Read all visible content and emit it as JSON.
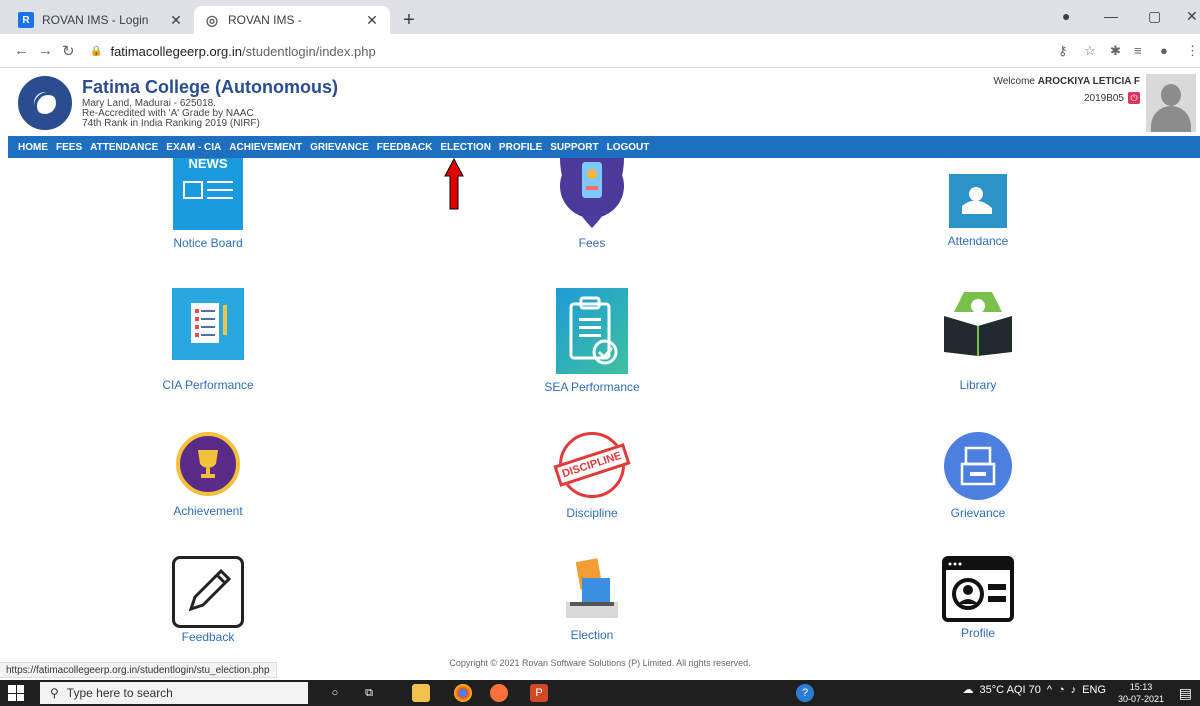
{
  "browser": {
    "tabs": [
      {
        "title": "ROVAN IMS - Login",
        "favicon": "R"
      },
      {
        "title": "ROVAN IMS -",
        "favicon": "globe"
      }
    ],
    "url_host": "fatimacollegeerp.org.in",
    "url_path": "/studentlogin/index.php",
    "status_url": "https://fatimacollegeerp.org.in/studentlogin/stu_election.php"
  },
  "header": {
    "college_name": "Fatima College (Autonomous)",
    "address": "Mary Land, Madurai - 625018.",
    "accreditation": "Re-Accredited with 'A' Grade by NAAC",
    "ranking": "74th Rank in India Ranking 2019 (NIRF)",
    "welcome_prefix": "Welcome",
    "student_name": "AROCKIYA LETICIA F",
    "roll_no": "2019B05"
  },
  "nav": {
    "items": [
      "HOME",
      "FEES",
      "ATTENDANCE",
      "EXAM - CIA",
      "ACHIEVEMENT",
      "GRIEVANCE",
      "FEEDBACK",
      "ELECTION",
      "PROFILE",
      "SUPPORT",
      "LOGOUT"
    ]
  },
  "tiles": {
    "notice_board": "Notice Board",
    "news_text": "NEWS",
    "fees": "Fees",
    "attendance": "Attendance",
    "cia_performance": "CIA Performance",
    "sea_performance": "SEA Performance",
    "library": "Library",
    "achievement": "Achievement",
    "discipline": "Discipline",
    "discipline_stamp": "DISCIPLINE",
    "grievance": "Grievance",
    "feedback": "Feedback",
    "election": "Election",
    "profile": "Profile"
  },
  "footer": {
    "copyright": "Copyright © 2021 Rovan Software Solutions (P) Limited. All rights reserved."
  },
  "taskbar": {
    "search_placeholder": "Type here to search",
    "weather": "35°C AQI 70",
    "lang": "ENG",
    "time": "15:13",
    "date": "30-07-2021"
  },
  "colors": {
    "nav_bg": "#1d6fbf",
    "label_blue": "#2f6eb5",
    "college_blue": "#2a4d8f",
    "arrow_red": "#e00000"
  }
}
